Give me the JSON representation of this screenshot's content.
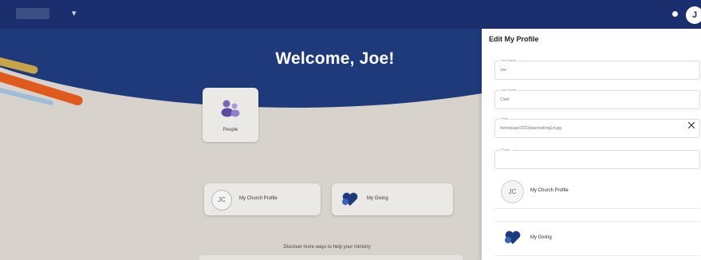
{
  "header": {
    "chevron": "▾",
    "avatar_initial": "J"
  },
  "hero": {
    "welcome": "Welcome, Joe!"
  },
  "tiles": {
    "people": "People",
    "church_profile_initials": "JC",
    "church_profile": "My Church Profile",
    "giving": "My Giving"
  },
  "footer": {
    "discover": "Discover more ways to help your ministry"
  },
  "panel": {
    "title": "Edit My Profile",
    "fields": {
      "first_name": {
        "label": "First Name",
        "value": "Joe"
      },
      "last_name": {
        "label": "Last Name",
        "value": "Clark"
      },
      "photo": {
        "label": "Photo",
        "value": "homepage/2023/plannedimg14.jpg"
      },
      "phone": {
        "label": "Phone",
        "value": ""
      }
    },
    "rows": {
      "church_profile_initials": "JC",
      "church_profile": "My Church Profile",
      "giving": "My Giving"
    }
  },
  "colors": {
    "topbar": "#1b2f6e",
    "hero": "#1e3a7a",
    "background": "#d7d2cc",
    "accent_orange": "#e05a1e",
    "accent_gold": "#c9a347",
    "heart_blue": "#1e3a7a"
  },
  "icons": {
    "people": "people-icon",
    "giving": "heart-icon",
    "clear": "close-icon"
  }
}
